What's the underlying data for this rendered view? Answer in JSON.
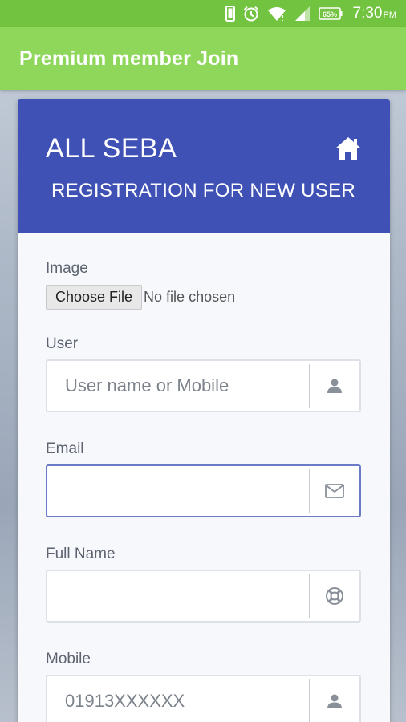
{
  "status_bar": {
    "battery": "65%",
    "time": "7:30",
    "ampm": "PM",
    "icons": [
      "phone-icon",
      "alarm-icon",
      "wifi-icon",
      "signal-icon",
      "battery-icon"
    ]
  },
  "app_bar": {
    "title": "Premium member Join",
    "color": "#8fd75a"
  },
  "card": {
    "brand": "ALL SEBA",
    "subtitle": "REGISTRATION FOR NEW USER",
    "header_color": "#3f51b5",
    "home_icon": "home-icon"
  },
  "form": {
    "image": {
      "label": "Image",
      "button": "Choose File",
      "status": "No file chosen"
    },
    "user": {
      "label": "User",
      "value": "",
      "placeholder": "User name or Mobile",
      "icon": "user-icon"
    },
    "email": {
      "label": "Email",
      "value": "",
      "placeholder": "",
      "icon": "envelope-icon",
      "focused": true
    },
    "full_name": {
      "label": "Full Name",
      "value": "",
      "placeholder": "",
      "icon": "lifebuoy-icon"
    },
    "mobile": {
      "label": "Mobile",
      "value": "",
      "placeholder": "01913XXXXXX",
      "icon": "user-icon"
    }
  }
}
